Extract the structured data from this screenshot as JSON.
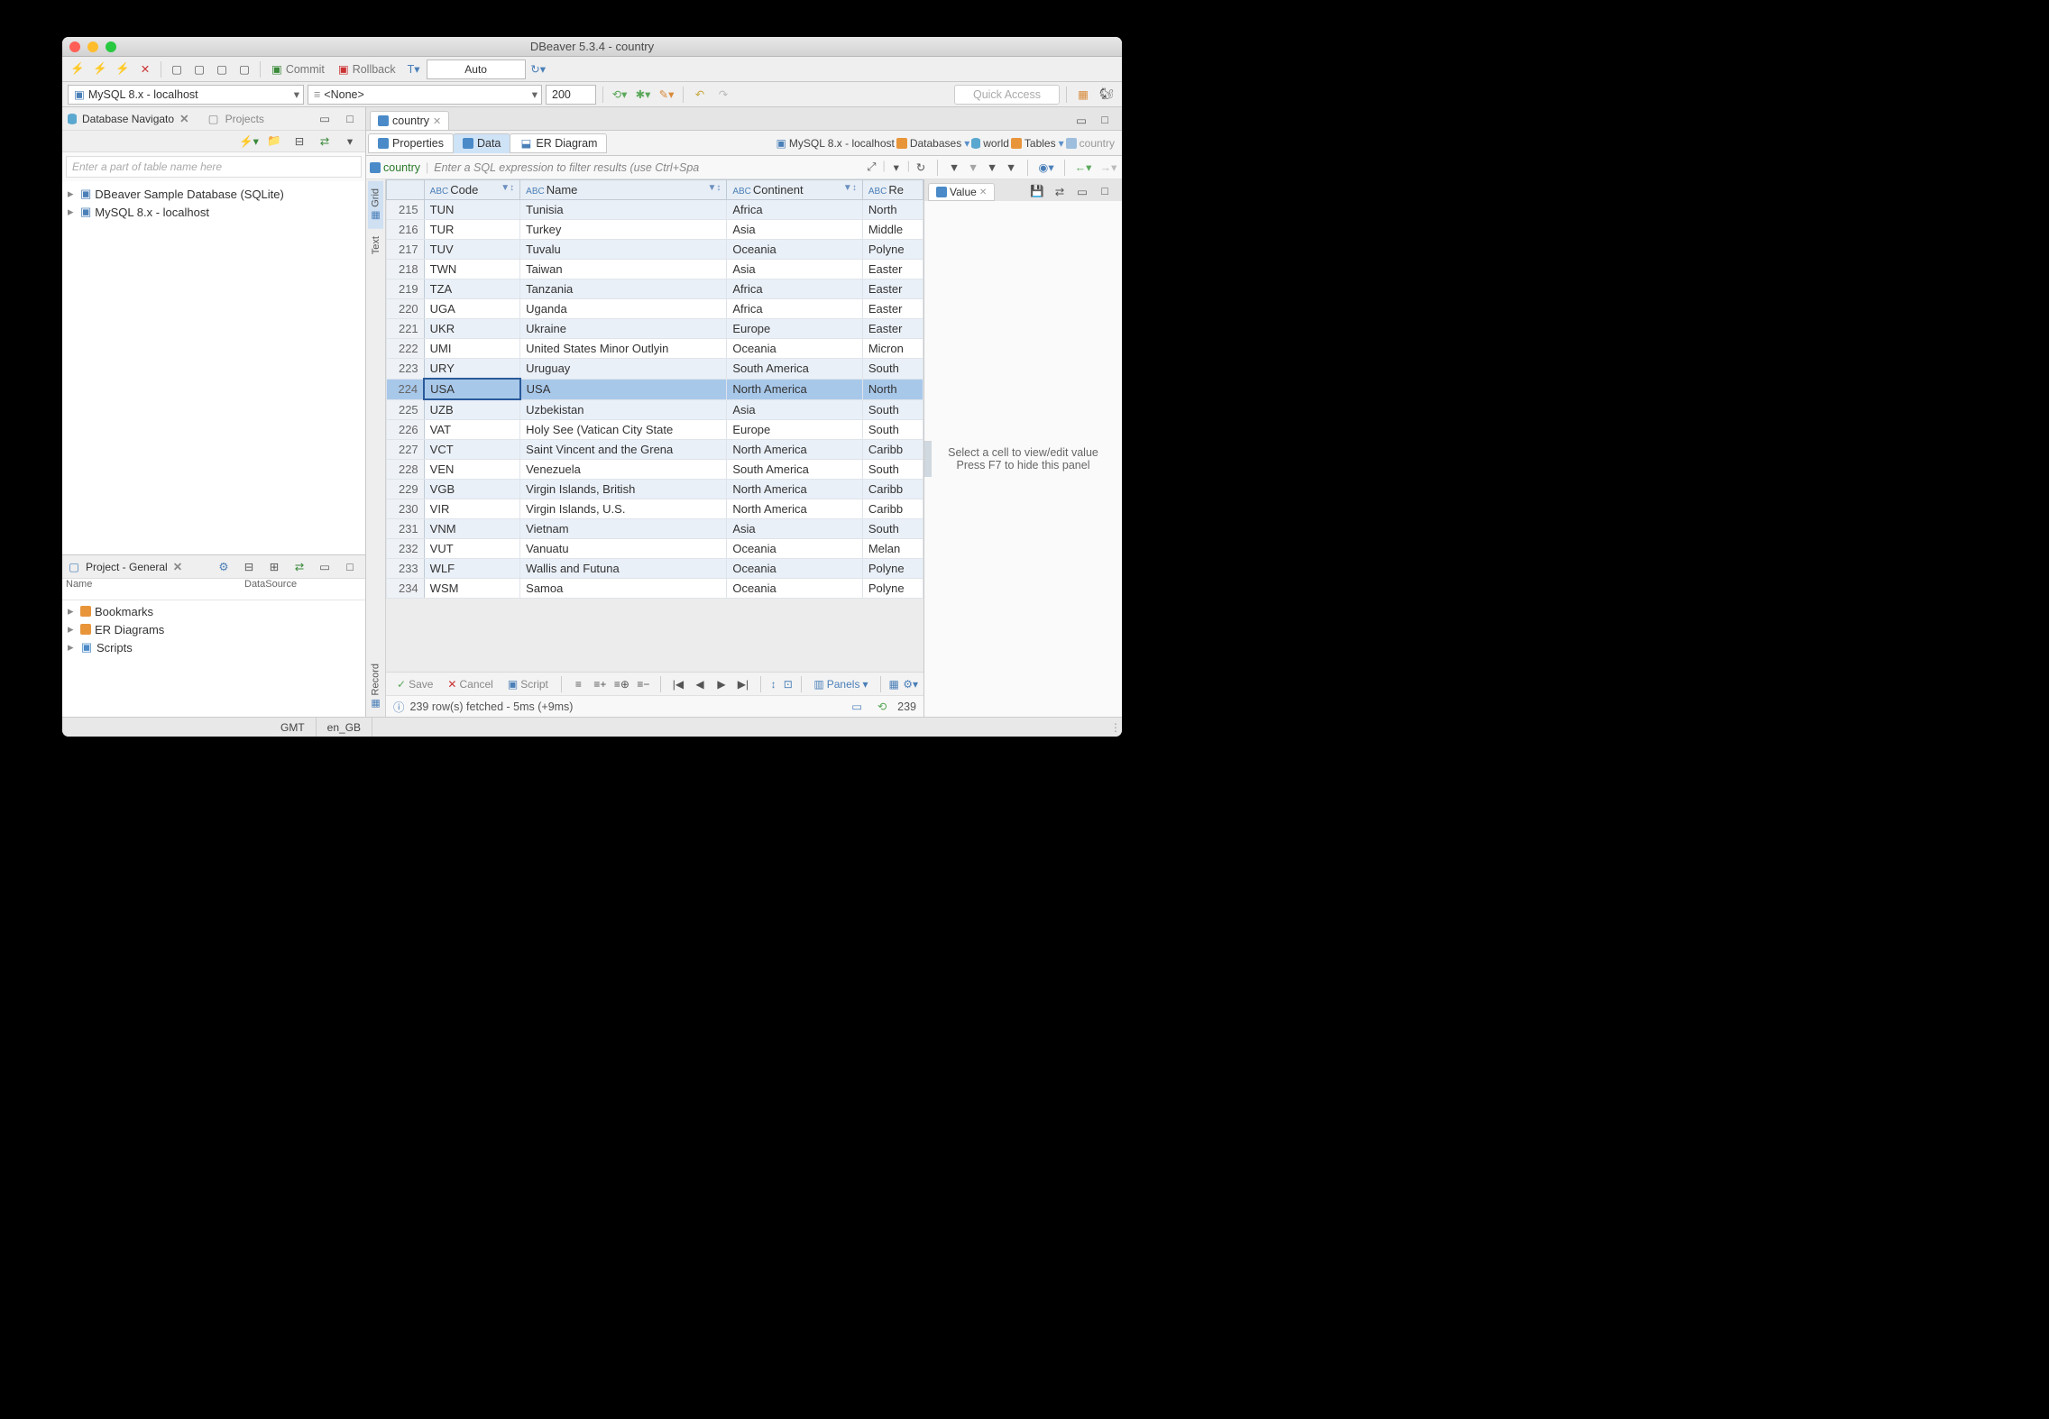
{
  "window_title": "DBeaver 5.3.4 - country",
  "toolbar1": {
    "commit": "Commit",
    "rollback": "Rollback",
    "mode": "Auto"
  },
  "toolbar2": {
    "connection": "MySQL 8.x - localhost",
    "schema": "<None>",
    "limit": "200",
    "quick_access": "Quick Access"
  },
  "navigator": {
    "title": "Database Navigato",
    "projects_tab": "Projects",
    "filter_placeholder": "Enter a part of table name here",
    "items": [
      "DBeaver Sample Database (SQLite)",
      "MySQL 8.x - localhost"
    ]
  },
  "project_panel": {
    "title": "Project - General",
    "col_name": "Name",
    "col_ds": "DataSource",
    "items": [
      "Bookmarks",
      "ER Diagrams",
      "Scripts"
    ]
  },
  "editor": {
    "tab": "country",
    "subtabs": {
      "properties": "Properties",
      "data": "Data",
      "er": "ER Diagram"
    },
    "breadcrumb": {
      "conn": "MySQL 8.x - localhost",
      "databases": "Databases",
      "db": "world",
      "tables": "Tables",
      "table": "country"
    },
    "filter_table": "country",
    "filter_hint": "Enter a SQL expression to filter results (use Ctrl+Spa",
    "sidetabs": {
      "grid": "Grid",
      "text": "Text",
      "record": "Record"
    }
  },
  "columns": [
    "Code",
    "Name",
    "Continent",
    "Re"
  ],
  "rows": [
    {
      "n": 215,
      "code": "TUN",
      "name": "Tunisia",
      "cont": "Africa",
      "reg": "North"
    },
    {
      "n": 216,
      "code": "TUR",
      "name": "Turkey",
      "cont": "Asia",
      "reg": "Middle"
    },
    {
      "n": 217,
      "code": "TUV",
      "name": "Tuvalu",
      "cont": "Oceania",
      "reg": "Polyne"
    },
    {
      "n": 218,
      "code": "TWN",
      "name": "Taiwan",
      "cont": "Asia",
      "reg": "Easter"
    },
    {
      "n": 219,
      "code": "TZA",
      "name": "Tanzania",
      "cont": "Africa",
      "reg": "Easter"
    },
    {
      "n": 220,
      "code": "UGA",
      "name": "Uganda",
      "cont": "Africa",
      "reg": "Easter"
    },
    {
      "n": 221,
      "code": "UKR",
      "name": "Ukraine",
      "cont": "Europe",
      "reg": "Easter"
    },
    {
      "n": 222,
      "code": "UMI",
      "name": "United States Minor Outlyin",
      "cont": "Oceania",
      "reg": "Micron"
    },
    {
      "n": 223,
      "code": "URY",
      "name": "Uruguay",
      "cont": "South America",
      "reg": "South"
    },
    {
      "n": 224,
      "code": "USA",
      "name": "USA",
      "cont": "North America",
      "reg": "North",
      "sel": true
    },
    {
      "n": 225,
      "code": "UZB",
      "name": "Uzbekistan",
      "cont": "Asia",
      "reg": "South"
    },
    {
      "n": 226,
      "code": "VAT",
      "name": "Holy See (Vatican City State",
      "cont": "Europe",
      "reg": "South"
    },
    {
      "n": 227,
      "code": "VCT",
      "name": "Saint Vincent and the Grena",
      "cont": "North America",
      "reg": "Caribb"
    },
    {
      "n": 228,
      "code": "VEN",
      "name": "Venezuela",
      "cont": "South America",
      "reg": "South"
    },
    {
      "n": 229,
      "code": "VGB",
      "name": "Virgin Islands, British",
      "cont": "North America",
      "reg": "Caribb"
    },
    {
      "n": 230,
      "code": "VIR",
      "name": "Virgin Islands, U.S.",
      "cont": "North America",
      "reg": "Caribb"
    },
    {
      "n": 231,
      "code": "VNM",
      "name": "Vietnam",
      "cont": "Asia",
      "reg": "South"
    },
    {
      "n": 232,
      "code": "VUT",
      "name": "Vanuatu",
      "cont": "Oceania",
      "reg": "Melan"
    },
    {
      "n": 233,
      "code": "WLF",
      "name": "Wallis and Futuna",
      "cont": "Oceania",
      "reg": "Polyne"
    },
    {
      "n": 234,
      "code": "WSM",
      "name": "Samoa",
      "cont": "Oceania",
      "reg": "Polyne"
    }
  ],
  "value_panel": {
    "tab": "Value",
    "hint1": "Select a cell to view/edit value",
    "hint2": "Press F7 to hide this panel"
  },
  "bottom": {
    "save": "Save",
    "cancel": "Cancel",
    "script": "Script",
    "panels": "Panels"
  },
  "status": {
    "msg": "239 row(s) fetched - 5ms (+9ms)",
    "count": "239"
  },
  "footer": {
    "tz": "GMT",
    "locale": "en_GB"
  }
}
